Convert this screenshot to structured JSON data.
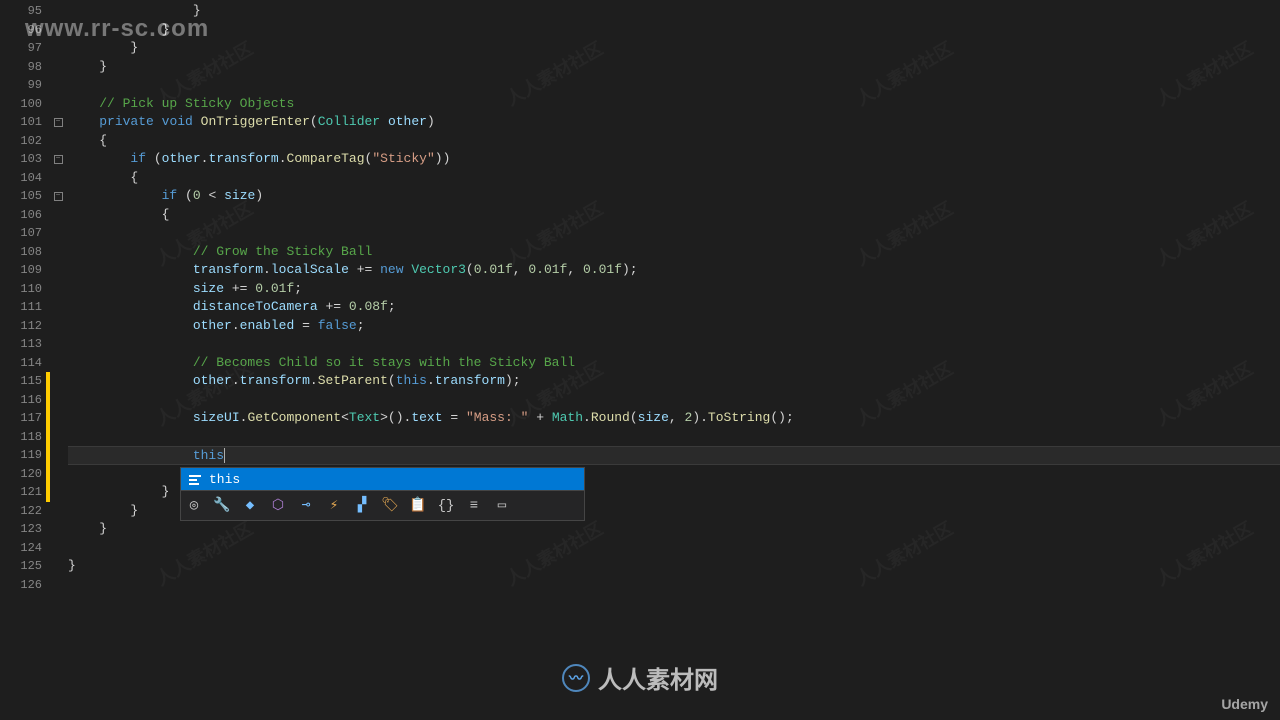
{
  "line_numbers": [
    95,
    96,
    97,
    98,
    99,
    100,
    101,
    102,
    103,
    104,
    105,
    106,
    107,
    108,
    109,
    110,
    111,
    112,
    113,
    114,
    115,
    116,
    117,
    118,
    119,
    120,
    121,
    122,
    123,
    124,
    125,
    126
  ],
  "current_line": 119,
  "changed_range_start": 115,
  "changed_range_end": 121,
  "code": {
    "l95": {
      "indent": "                ",
      "text": "}",
      "tokens": [
        {
          "t": "}",
          "c": "plain"
        }
      ]
    },
    "l96": {
      "indent": "            ",
      "text": "}",
      "tokens": [
        {
          "t": "}",
          "c": "plain"
        }
      ]
    },
    "l97": {
      "indent": "        ",
      "text": "}",
      "tokens": [
        {
          "t": "}",
          "c": "plain"
        }
      ]
    },
    "l98": {
      "indent": "    ",
      "text": "}",
      "tokens": [
        {
          "t": "}",
          "c": "plain"
        }
      ]
    },
    "l100_comment": "// Pick up Sticky Objects",
    "l101": {
      "kw1": "private",
      "kw2": "void",
      "method": "OnTriggerEnter",
      "type": "Collider",
      "param": "other"
    },
    "l103": {
      "kw": "if",
      "p": "other",
      "m1": "transform",
      "m2": "CompareTag",
      "str": "\"Sticky\""
    },
    "l105": {
      "kw": "if",
      "n": "0",
      "p": "size"
    },
    "l108_comment": "// Grow the Sticky Ball",
    "l109": {
      "p": "transform",
      "m": "localScale",
      "kw": "new",
      "type": "Vector3",
      "n": "0.01f"
    },
    "l110": {
      "p": "size",
      "n": "0.01f"
    },
    "l111": {
      "p": "distanceToCamera",
      "n": "0.08f"
    },
    "l112": {
      "p": "other",
      "m": "enabled",
      "kw": "false"
    },
    "l114_comment": "// Becomes Child so it stays with the Sticky Ball",
    "l115": {
      "p": "other",
      "m1": "transform",
      "m2": "SetParent",
      "kw": "this",
      "m3": "transform"
    },
    "l117": {
      "p1": "sizeUI",
      "m1": "GetComponent",
      "type": "Text",
      "m2": "text",
      "str": "\"Mass: \"",
      "cls": "Math",
      "m3": "Round",
      "p2": "size",
      "n1": "2",
      "m4": "ToString"
    },
    "l119": {
      "kw": "this"
    }
  },
  "intellisense": {
    "selected": "this",
    "toolbar_icons": [
      "target-icon",
      "wrench-icon",
      "cube-icon",
      "hexagon-icon",
      "key-icon",
      "lightning-icon",
      "panels-icon",
      "tags-icon",
      "clipboard-icon",
      "braces-icon",
      "lines-icon",
      "tablet-icon"
    ]
  },
  "watermarks": {
    "top_left": "www.rr-sc.com",
    "bottom_right": "Udemy",
    "center": "人人素材网",
    "bg": "人人素材社区"
  }
}
